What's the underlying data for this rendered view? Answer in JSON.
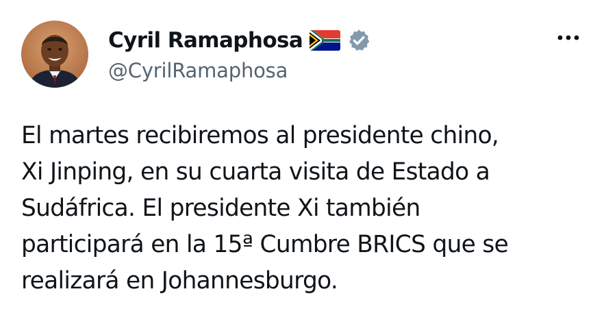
{
  "tweet": {
    "author": {
      "display_name": "Cyril Ramaphosa",
      "handle": "@CyrilRamaphosa",
      "avatar": "avatar-photo",
      "flag": "south-africa-flag-icon",
      "verified": "verified-badge-icon"
    },
    "more_icon": "more-options-icon",
    "text": "El martes recibiremos al presidente chino,\nXi Jinping, en su cuarta visita de Estado a\nSudáfrica. El presidente Xi también\nparticipará en la 15ª Cumbre BRICS que se\nrealizará en Johannesburgo."
  },
  "colors": {
    "text": "#0f1419",
    "secondary": "#536471",
    "verified": "#829aab"
  }
}
